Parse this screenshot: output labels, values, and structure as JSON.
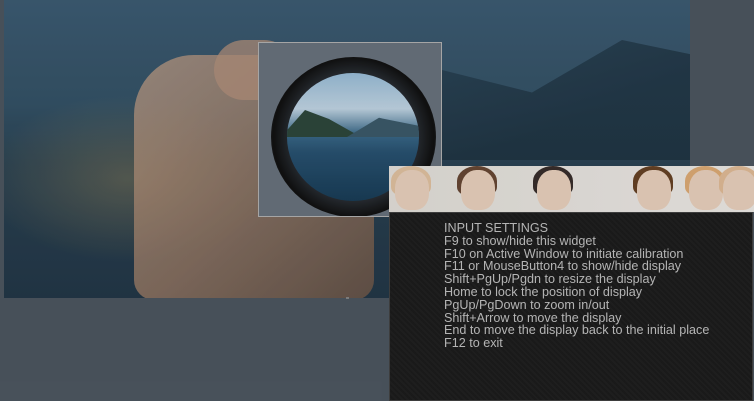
{
  "settings": {
    "title": "INPUT SETTINGS",
    "lines": [
      "F9 to show/hide this widget",
      "F10 on Active Window to initiate calibration",
      "F11 or MouseButton4 to show/hide display",
      "Shift+PgUp/Pgdn to resize the display",
      "Home to lock the position of display",
      "PgUp/PgDown to zoom in/out",
      "Shift+Arrow to move the display",
      "End to move the display back to the initial place",
      "F12 to exit"
    ]
  },
  "colors": {
    "panel_background": "#1d1d1d",
    "panel_text": "#c9c9c9",
    "desktop_background": "#505a64"
  },
  "icons": {
    "magnifier_display": "lens-magnifier-icon",
    "banner": "anime-characters-banner-icon"
  }
}
